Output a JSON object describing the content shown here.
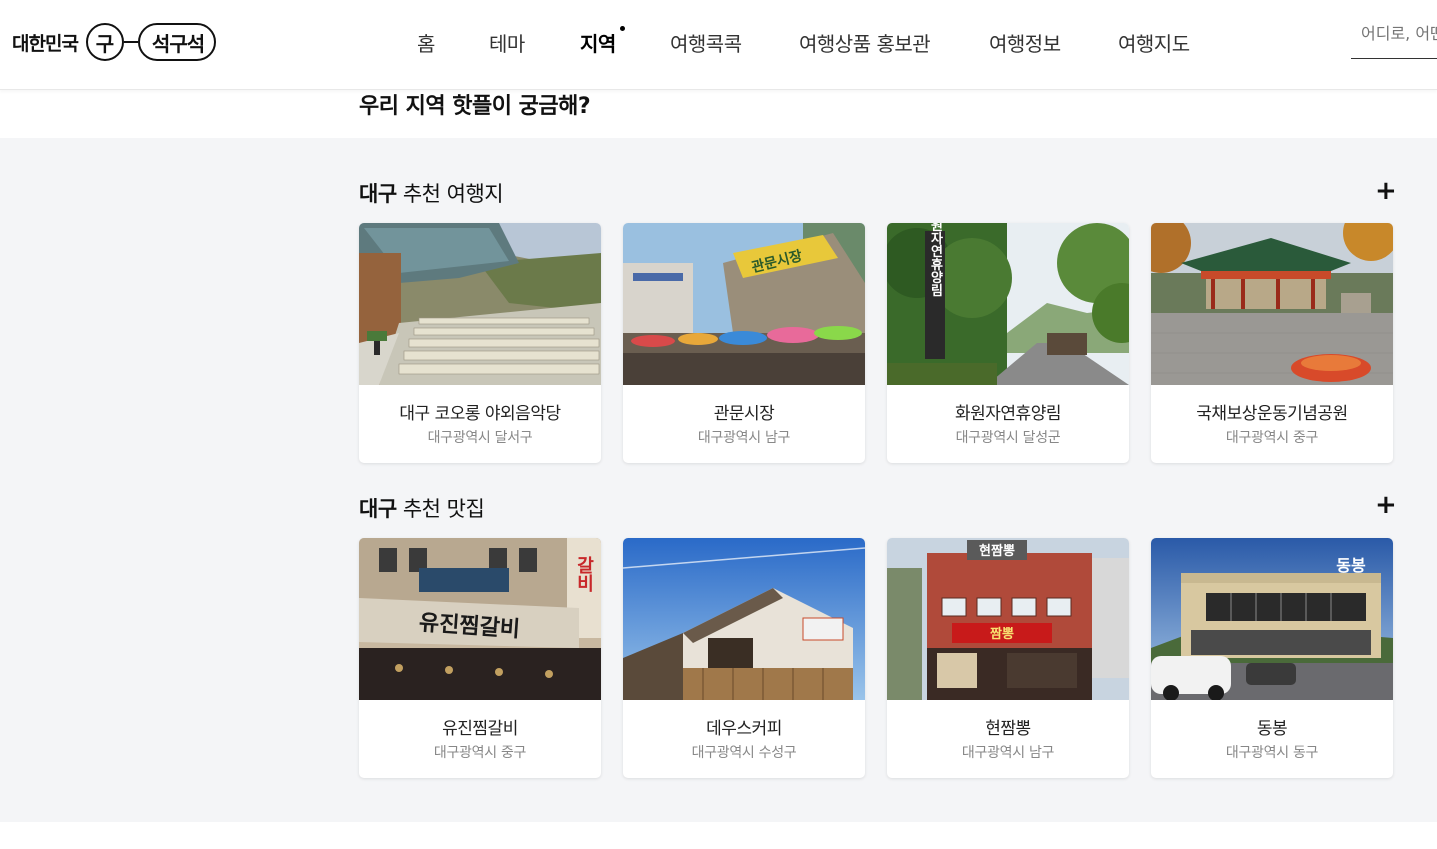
{
  "logo": {
    "prefix": "대한민국",
    "circle": "구",
    "pill": "석구석"
  },
  "nav": [
    {
      "label": "홈",
      "active": false
    },
    {
      "label": "테마",
      "active": false
    },
    {
      "label": "지역",
      "active": true
    },
    {
      "label": "여행콕콕",
      "active": false
    },
    {
      "label": "여행상품 홍보관",
      "active": false
    },
    {
      "label": "여행정보",
      "active": false
    },
    {
      "label": "여행지도",
      "active": false
    }
  ],
  "search": {
    "placeholder": "어디로, 어떤 여행을 떠날 싶으신가요?"
  },
  "question": "우리 지역 핫플이 궁금해?",
  "sections": [
    {
      "region": "대구",
      "title": " 추천 여행지",
      "cards": [
        {
          "name": "대구 코오롱 야외음악당",
          "location": "대구광역시 달서구"
        },
        {
          "name": "관문시장",
          "location": "대구광역시 남구"
        },
        {
          "name": "화원자연휴양림",
          "location": "대구광역시 달성군"
        },
        {
          "name": "국채보상운동기념공원",
          "location": "대구광역시 중구"
        }
      ]
    },
    {
      "region": "대구",
      "title": " 추천 맛집",
      "cards": [
        {
          "name": "유진찜갈비",
          "location": "대구광역시 중구"
        },
        {
          "name": "데우스커피",
          "location": "대구광역시 수성구"
        },
        {
          "name": "현짬뽕",
          "location": "대구광역시 남구"
        },
        {
          "name": "동봉",
          "location": "대구광역시 동구"
        }
      ]
    }
  ],
  "plus_label": "+",
  "photo_text": {
    "market_sign": "관문시장",
    "forest_sign": "화원자연휴양림",
    "galbi_vertical": "갈비",
    "galbi_sign": "유진찜갈비",
    "jjambbong_sign": "짬뽕",
    "hyeon_sign": "현짬뽕",
    "dongbong_sign": "동봉"
  }
}
